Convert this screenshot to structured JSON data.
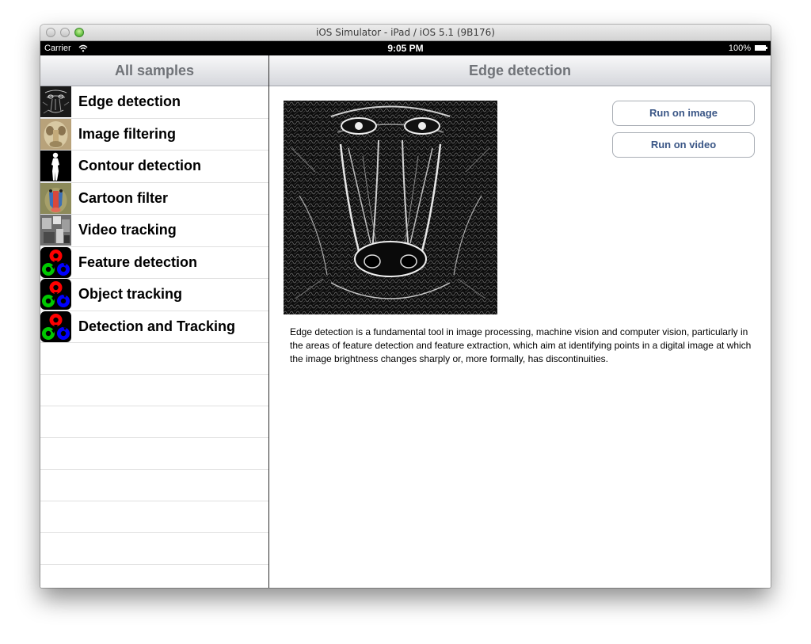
{
  "window": {
    "title": "iOS Simulator - iPad / iOS 5.1 (9B176)"
  },
  "statusbar": {
    "carrier": "Carrier",
    "time": "9:05 PM",
    "battery": "100%"
  },
  "master": {
    "title": "All samples",
    "items": [
      {
        "label": "Edge detection",
        "icon": "edge-mandrill-thumb"
      },
      {
        "label": "Image filtering",
        "icon": "image-filter-thumb"
      },
      {
        "label": "Contour detection",
        "icon": "contour-silhouette-thumb"
      },
      {
        "label": "Cartoon filter",
        "icon": "cartoon-mandrill-thumb"
      },
      {
        "label": "Video tracking",
        "icon": "video-tracking-thumb"
      },
      {
        "label": "Feature detection",
        "icon": "opencv-logo-thumb"
      },
      {
        "label": "Object tracking",
        "icon": "opencv-logo-thumb"
      },
      {
        "label": "Detection and Tracking",
        "icon": "opencv-logo-thumb"
      }
    ]
  },
  "detail": {
    "title": "Edge detection",
    "run_image_label": "Run on image",
    "run_video_label": "Run on video",
    "description": "Edge detection is a fundamental tool in image processing, machine vision and computer vision, particularly in the areas of feature detection and feature extraction, which aim at identifying points in a digital image at which the image brightness changes sharply or, more formally, has discontinuities."
  }
}
